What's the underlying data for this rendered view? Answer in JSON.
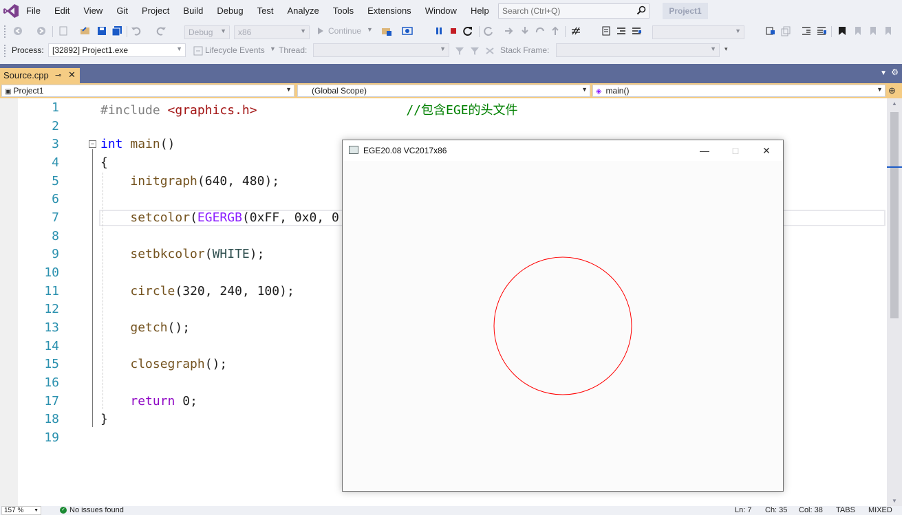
{
  "menubar": {
    "items": [
      "File",
      "Edit",
      "View",
      "Git",
      "Project",
      "Build",
      "Debug",
      "Test",
      "Analyze",
      "Tools",
      "Extensions",
      "Window",
      "Help"
    ],
    "search_placeholder": "Search (Ctrl+Q)",
    "project_badge": "Project1"
  },
  "toolbar": {
    "config": "Debug",
    "platform": "x86",
    "continue_label": "Continue",
    "process_label": "Process:",
    "process_value": "[32892] Project1.exe",
    "lifecycle_label": "Lifecycle Events",
    "thread_label": "Thread:",
    "stack_label": "Stack Frame:"
  },
  "tabs": {
    "active": "Source.cpp",
    "pin": "⊸",
    "close": "✕"
  },
  "navbar": {
    "project": "Project1",
    "scope": "(Global Scope)",
    "member": "main()"
  },
  "editor": {
    "line_numbers": [
      "1",
      "2",
      "3",
      "4",
      "5",
      "6",
      "7",
      "8",
      "9",
      "10",
      "11",
      "12",
      "13",
      "14",
      "15",
      "16",
      "17",
      "18",
      "19"
    ],
    "collapse_glyph": "−"
  },
  "ege_window": {
    "title": "EGE20.08 VC2017x86",
    "minimize": "—",
    "maximize": "□",
    "close": "✕",
    "circle_color": "#ff0000",
    "background": "#ffffff"
  },
  "status": {
    "zoom": "157 %",
    "issues": "No issues found",
    "ln": "Ln: 7",
    "ch": "Ch: 35",
    "col": "Col: 38",
    "tabs": "TABS",
    "eol": "MIXED"
  },
  "colors": {
    "accent_tab": "#f5cc84",
    "docwell": "#5d6b99",
    "line_number": "#2b91af",
    "keyword": "#0000ff"
  }
}
